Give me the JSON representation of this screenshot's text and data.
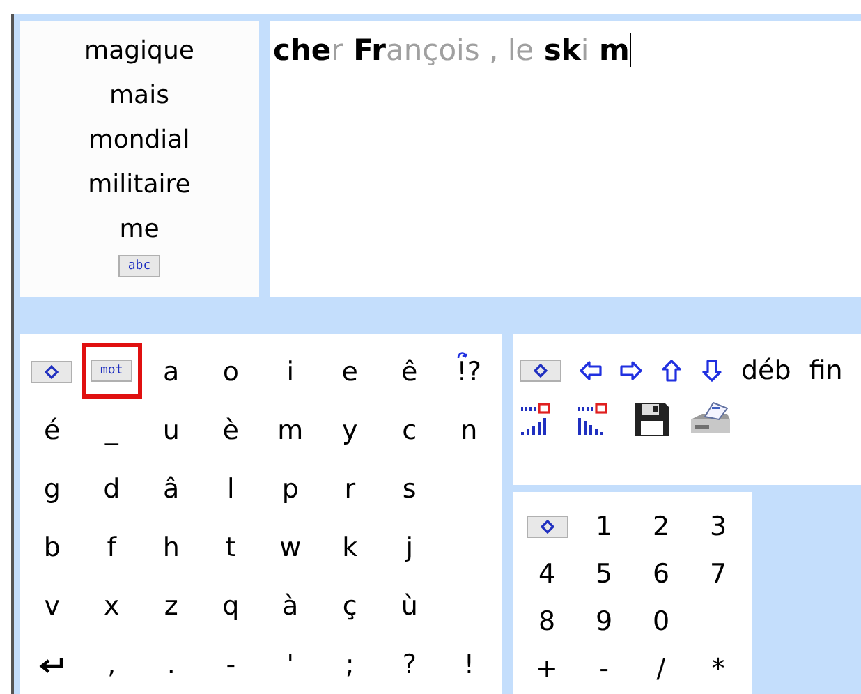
{
  "suggestions": [
    {
      "label": "magique"
    },
    {
      "label": "mais"
    },
    {
      "label": "mondial"
    },
    {
      "label": "militaire"
    },
    {
      "label": "me"
    }
  ],
  "suggestion_button": {
    "label": "abc"
  },
  "text": [
    {
      "text": "che",
      "predicted": false
    },
    {
      "text": "r",
      "predicted": true
    },
    {
      "text": " Fr",
      "predicted": false
    },
    {
      "text": "ançois , le",
      "predicted": true
    },
    {
      "text": " sk",
      "predicted": false
    },
    {
      "text": "i",
      "predicted": true
    },
    {
      "text": " m",
      "predicted": false
    }
  ],
  "keyboard": [
    [
      {
        "kind": "grid"
      },
      {
        "kind": "word",
        "label": "mot",
        "selected": true
      },
      {
        "kind": "char",
        "label": "a"
      },
      {
        "kind": "char",
        "label": "o"
      },
      {
        "kind": "char",
        "label": "i"
      },
      {
        "kind": "char",
        "label": "e"
      },
      {
        "kind": "char",
        "label": "ê"
      },
      {
        "kind": "toggle",
        "label": "!?"
      }
    ],
    [
      {
        "kind": "char",
        "label": "é"
      },
      {
        "kind": "char",
        "label": "_"
      },
      {
        "kind": "char",
        "label": "u"
      },
      {
        "kind": "char",
        "label": "è"
      },
      {
        "kind": "char",
        "label": "m"
      },
      {
        "kind": "char",
        "label": "y"
      },
      {
        "kind": "char",
        "label": "c"
      },
      {
        "kind": "char",
        "label": "n"
      }
    ],
    [
      {
        "kind": "char",
        "label": "g"
      },
      {
        "kind": "char",
        "label": "d"
      },
      {
        "kind": "char",
        "label": "â"
      },
      {
        "kind": "char",
        "label": "l"
      },
      {
        "kind": "char",
        "label": "p"
      },
      {
        "kind": "char",
        "label": "r"
      },
      {
        "kind": "char",
        "label": "s"
      }
    ],
    [
      {
        "kind": "char",
        "label": "b"
      },
      {
        "kind": "char",
        "label": "f"
      },
      {
        "kind": "char",
        "label": "h"
      },
      {
        "kind": "char",
        "label": "t"
      },
      {
        "kind": "char",
        "label": "w"
      },
      {
        "kind": "char",
        "label": "k"
      },
      {
        "kind": "char",
        "label": "j"
      }
    ],
    [
      {
        "kind": "char",
        "label": "v"
      },
      {
        "kind": "char",
        "label": "x"
      },
      {
        "kind": "char",
        "label": "z"
      },
      {
        "kind": "char",
        "label": "q"
      },
      {
        "kind": "char",
        "label": "à"
      },
      {
        "kind": "char",
        "label": "ç"
      },
      {
        "kind": "char",
        "label": "ù"
      }
    ],
    [
      {
        "kind": "enter"
      },
      {
        "kind": "char",
        "label": ","
      },
      {
        "kind": "char",
        "label": "."
      },
      {
        "kind": "char",
        "label": "-"
      },
      {
        "kind": "char",
        "label": "'"
      },
      {
        "kind": "char",
        "label": ";"
      },
      {
        "kind": "char",
        "label": "?"
      },
      {
        "kind": "char",
        "label": "!"
      }
    ]
  ],
  "navigation": [
    [
      {
        "kind": "grid"
      },
      {
        "kind": "left"
      },
      {
        "kind": "right"
      },
      {
        "kind": "up"
      },
      {
        "kind": "down"
      },
      {
        "kind": "text",
        "label": "déb"
      },
      {
        "kind": "text",
        "label": "fin"
      }
    ],
    [
      {
        "kind": "signal-up"
      },
      {
        "kind": "signal-down"
      },
      {
        "kind": "save"
      },
      {
        "kind": "print"
      }
    ]
  ],
  "numbers": [
    [
      {
        "kind": "grid"
      },
      {
        "kind": "char",
        "label": "1"
      },
      {
        "kind": "char",
        "label": "2"
      },
      {
        "kind": "char",
        "label": "3"
      }
    ],
    [
      {
        "kind": "char",
        "label": "4"
      },
      {
        "kind": "char",
        "label": "5"
      },
      {
        "kind": "char",
        "label": "6"
      },
      {
        "kind": "char",
        "label": "7"
      }
    ],
    [
      {
        "kind": "char",
        "label": "8"
      },
      {
        "kind": "char",
        "label": "9"
      },
      {
        "kind": "char",
        "label": "0"
      }
    ],
    [
      {
        "kind": "char",
        "label": "+"
      },
      {
        "kind": "char",
        "label": "-"
      },
      {
        "kind": "char",
        "label": "/"
      },
      {
        "kind": "char",
        "label": "*"
      }
    ]
  ]
}
